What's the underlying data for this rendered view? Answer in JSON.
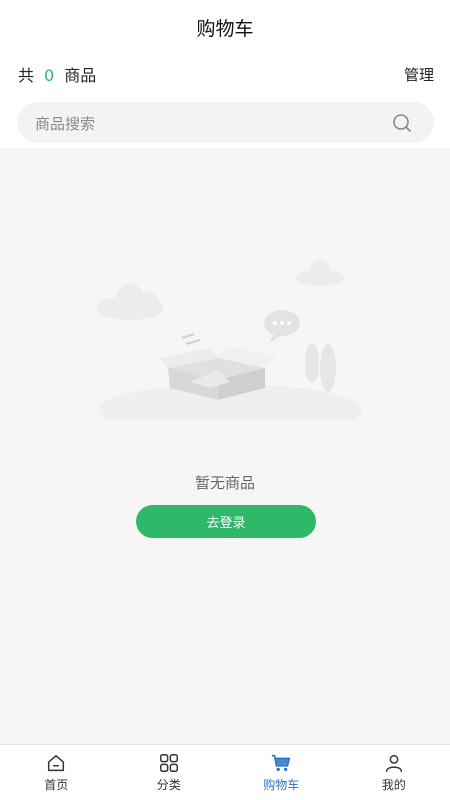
{
  "header": {
    "title": "购物车"
  },
  "cart": {
    "count_prefix": "共",
    "count": "0",
    "count_suffix": "商品",
    "manage_label": "管理"
  },
  "search": {
    "placeholder": "商品搜索"
  },
  "empty": {
    "text": "暂无商品",
    "login_label": "去登录"
  },
  "tabbar": {
    "items": [
      {
        "label": "首页",
        "icon": "home-icon"
      },
      {
        "label": "分类",
        "icon": "grid-icon"
      },
      {
        "label": "购物车",
        "icon": "cart-icon",
        "active": true
      },
      {
        "label": "我的",
        "icon": "user-icon"
      }
    ]
  },
  "colors": {
    "accent": "#2fb86a",
    "active_tab": "#2a73c9"
  }
}
